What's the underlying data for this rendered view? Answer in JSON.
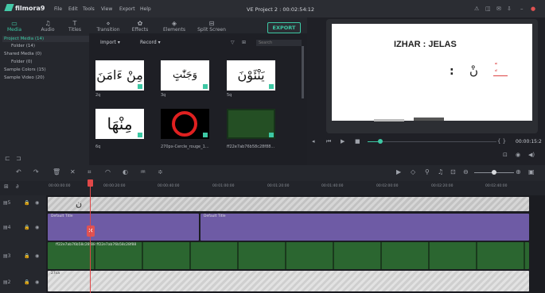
{
  "app": {
    "logo": "filmora9",
    "title": "VE Project 2 : 00:02:54:12"
  },
  "menu": [
    "File",
    "Edit",
    "Tools",
    "View",
    "Export",
    "Help"
  ],
  "tabs": [
    {
      "label": "Media",
      "icon": "folder-icon",
      "active": true
    },
    {
      "label": "Audio",
      "icon": "music-icon"
    },
    {
      "label": "Titles",
      "icon": "text-icon"
    },
    {
      "label": "Transition",
      "icon": "transition-icon"
    },
    {
      "label": "Effects",
      "icon": "effects-icon"
    },
    {
      "label": "Elements",
      "icon": "elements-icon"
    },
    {
      "label": "Split Screen",
      "icon": "split-screen-icon"
    }
  ],
  "export_label": "EXPORT",
  "sidebar": [
    "Project Media (14)",
    "Folder (14)",
    "Shared Media (0)",
    "Folder (0)",
    "Sample Colors (15)",
    "Sample Video (20)"
  ],
  "media_bar": {
    "import": "Import",
    "record": "Record",
    "search_placeholder": "Search"
  },
  "thumbs": [
    {
      "label": "2q",
      "arabic": "مِنْ ءَامَنَ"
    },
    {
      "label": "3q",
      "arabic": "وَجَنّٰتٍ أَلْفَافًا"
    },
    {
      "label": "5q",
      "arabic": "يَنْئَوْنَ"
    },
    {
      "label": "6q",
      "arabic": "مِنْهَا"
    },
    {
      "label": "270px-Cercle_rouge_1...",
      "arabic": ""
    },
    {
      "label": "ff22e7ab76b58c28f88...",
      "arabic": ""
    }
  ],
  "preview": {
    "heading": "IZHAR : JELAS",
    "colon": ":",
    "nun": "نْ",
    "marks": "ً ٍ",
    "timecode": "00:00:15:2"
  },
  "ruler": [
    "00:00:00:00",
    "00:00:20:00",
    "00:00:40:00",
    "00:01:00:00",
    "00:01:20:00",
    "00:01:40:00",
    "00:02:00:00",
    "00:02:20:00",
    "00:02:40:00"
  ],
  "tracks": {
    "t5_clip": "ن",
    "t4_clip_a": "Default Title",
    "t4_clip_b": "Default Title",
    "t3_clip": "ff22e7ab76b58c28f88 ff22e7ab76b58c28f88",
    "t2_clip": "27ca",
    "labels": [
      "5",
      "4",
      "3",
      "2"
    ]
  }
}
